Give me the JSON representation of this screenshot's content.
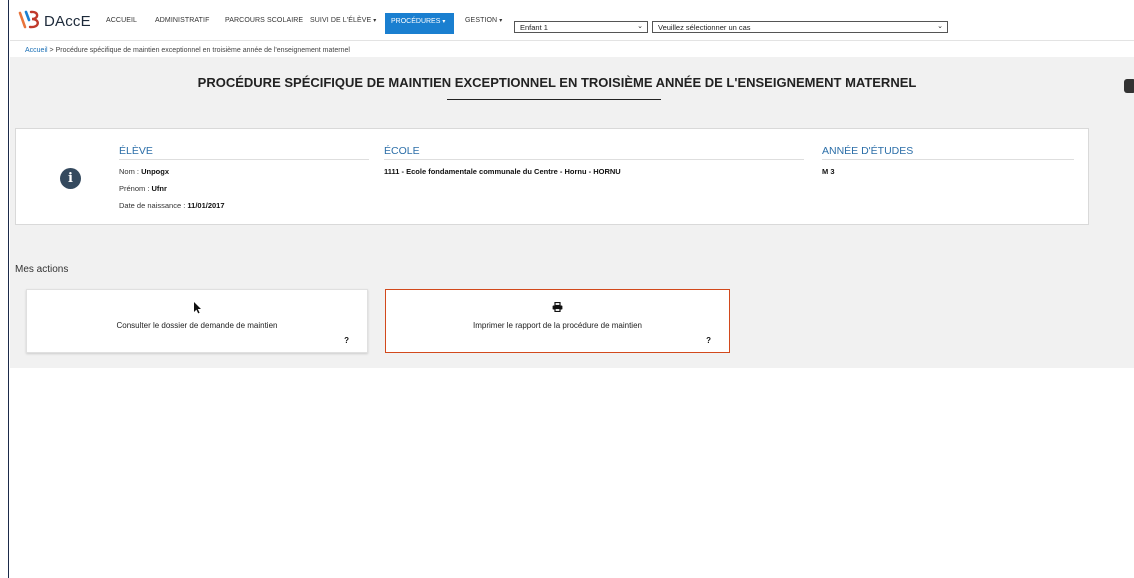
{
  "brand": {
    "name": "DAccE",
    "colors": {
      "orange": "#e8743b",
      "blue": "#1a7fd0",
      "red": "#c0392b"
    }
  },
  "nav": {
    "items": [
      {
        "label": "ACCUEIL"
      },
      {
        "label": "ADMINISTRATIF"
      },
      {
        "label": "PARCOURS SCOLAIRE"
      },
      {
        "label": "SUIVI DE L'ÉLÈVE"
      },
      {
        "label": "PROCÉDURES"
      },
      {
        "label": "GESTION"
      }
    ],
    "child_select": {
      "value": "Enfant 1"
    },
    "case_select": {
      "placeholder": "Veuillez sélectionner un cas"
    }
  },
  "breadcrumb": {
    "home": "Accueil",
    "separator": " > ",
    "current": "Procédure spécifique de maintien exceptionnel en troisième année de l'enseignement maternel"
  },
  "page": {
    "title": "PROCÉDURE SPÉCIFIQUE DE MAINTIEN EXCEPTIONNEL EN TROISIÈME ANNÉE DE L'ENSEIGNEMENT MATERNEL"
  },
  "student": {
    "section_title": "ÉLÈVE",
    "last_name_label": "Nom : ",
    "last_name": "Unpogx",
    "first_name_label": "Prénom : ",
    "first_name": "Ufnr",
    "birth_label": "Date de naissance : ",
    "birth_date": "11/01/2017"
  },
  "school": {
    "section_title": "ÉCOLE",
    "name": "1111 - Ecole fondamentale communale du Centre - Hornu - HORNU"
  },
  "year": {
    "section_title": "ANNÉE D'ÉTUDES",
    "value": "M 3"
  },
  "actions": {
    "title": "Mes actions",
    "items": [
      {
        "icon": "pointer-icon",
        "label": "Consulter le dossier de demande de maintien",
        "help": "?"
      },
      {
        "icon": "print-icon",
        "label": "Imprimer le rapport de la procédure de maintien",
        "help": "?"
      }
    ]
  }
}
